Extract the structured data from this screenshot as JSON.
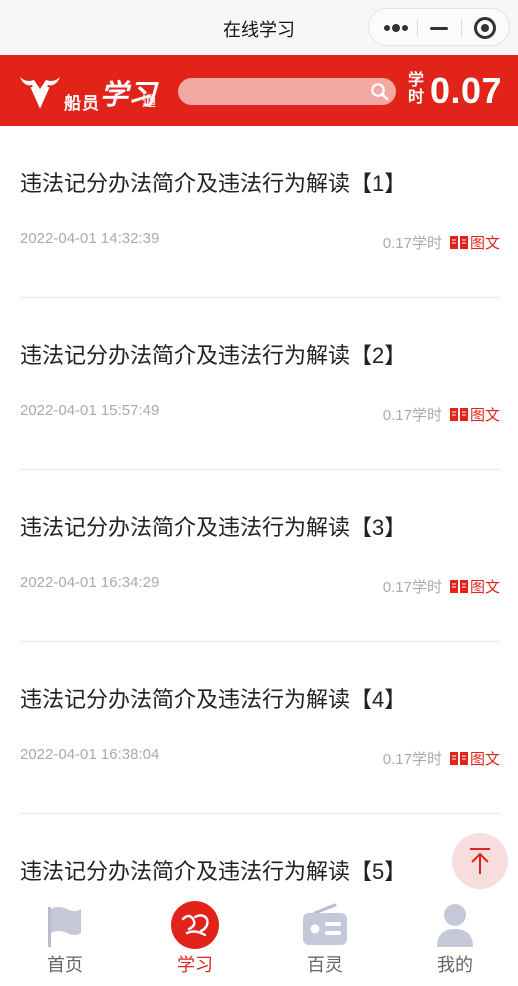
{
  "window": {
    "title": "在线学习"
  },
  "header": {
    "logo_name": "船员",
    "logo_script": "学习",
    "logo_suffix": "通",
    "hours_label": "学时",
    "hours_value": "0.07"
  },
  "search": {
    "placeholder": ""
  },
  "items": [
    {
      "title": "违法记分办法简介及违法行为解读【1】",
      "date": "2022-04-01 14:32:39",
      "hours": "0.17学时",
      "type": "图文"
    },
    {
      "title": "违法记分办法简介及违法行为解读【2】",
      "date": "2022-04-01 15:57:49",
      "hours": "0.17学时",
      "type": "图文"
    },
    {
      "title": "违法记分办法简介及违法行为解读【3】",
      "date": "2022-04-01 16:34:29",
      "hours": "0.17学时",
      "type": "图文"
    },
    {
      "title": "违法记分办法简介及违法行为解读【4】",
      "date": "2022-04-01 16:38:04",
      "hours": "0.17学时",
      "type": "图文"
    },
    {
      "title": "违法记分办法简介及违法行为解读【5】",
      "date": "",
      "hours": "",
      "type": ""
    }
  ],
  "tabbar": [
    {
      "label": "首页",
      "icon": "flag-icon",
      "active": false
    },
    {
      "label": "学习",
      "icon": "xuexi-logo-icon",
      "active": true
    },
    {
      "label": "百灵",
      "icon": "radio-icon",
      "active": false
    },
    {
      "label": "我的",
      "icon": "user-icon",
      "active": false
    }
  ],
  "colors": {
    "brand_red": "#e2231a",
    "search_bg": "#f2a9a4",
    "meta_gray": "#aaaaaa"
  }
}
